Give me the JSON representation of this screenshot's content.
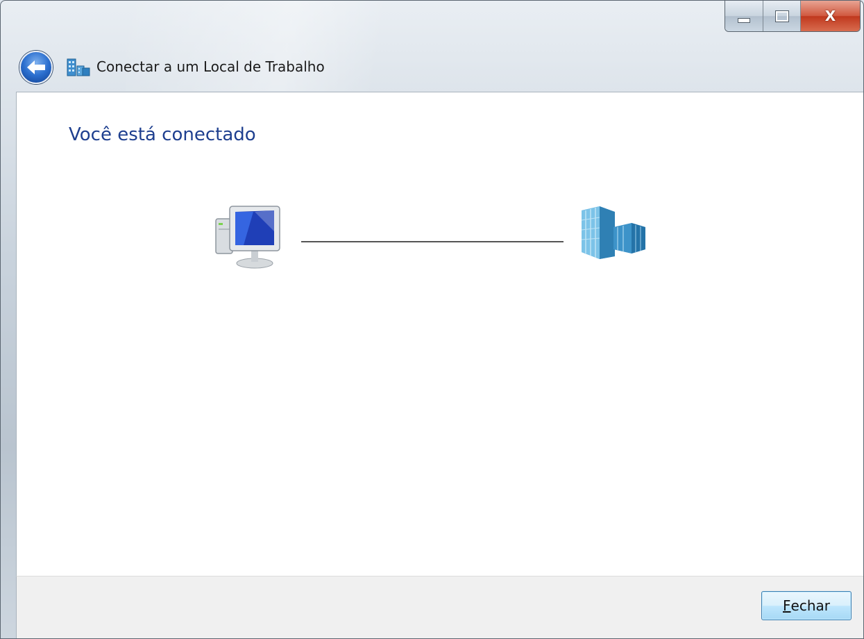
{
  "window": {
    "title": "Conectar a um Local de Trabalho",
    "close_glyph": "X"
  },
  "icons": {
    "back": "back-arrow-icon",
    "app": "workplace-building-icon",
    "local": "computer-icon",
    "remote": "office-building-icon"
  },
  "content": {
    "heading": "Você está conectado"
  },
  "footer": {
    "close_button_mnemonic": "F",
    "close_button_rest": "echar"
  },
  "colors": {
    "heading": "#1e3f8f",
    "close_button_border": "#3c7fb1",
    "caption_close": "#c7391e"
  }
}
